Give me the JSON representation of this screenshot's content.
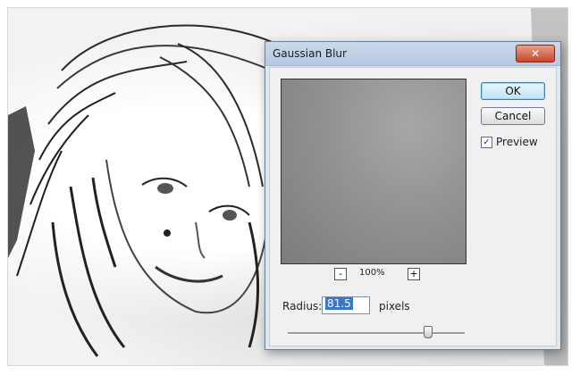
{
  "dialog": {
    "title": "Gaussian Blur",
    "close_icon": "close-icon",
    "ok_label": "OK",
    "cancel_label": "Cancel",
    "preview_label": "Preview",
    "preview_checked": true,
    "zoom": {
      "minus_label": "-",
      "value": "100%",
      "plus_label": "+"
    },
    "radius": {
      "label": "Radius:",
      "value": "81.5",
      "units": "pixels",
      "slider_fraction": 0.78
    }
  },
  "colors": {
    "dialog_bg": "#dfe7f0",
    "titlebar": "#b5c9e2",
    "close_button": "#c9462a",
    "selection": "#3b77c6"
  }
}
